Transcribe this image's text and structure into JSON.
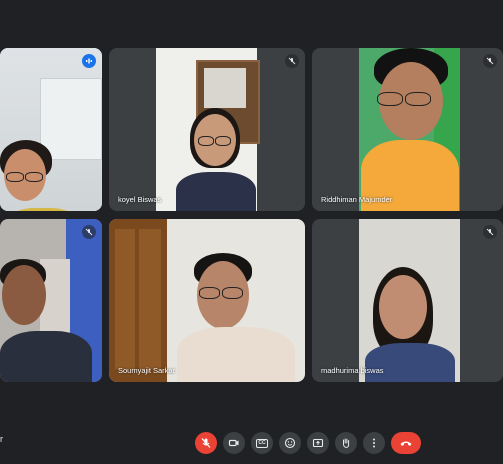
{
  "participants": [
    {
      "name": "",
      "muted": false,
      "speaking": true
    },
    {
      "name": "koyel Biswas",
      "muted": true
    },
    {
      "name": "Riddhiman Majumder",
      "muted": true
    },
    {
      "name": "",
      "muted": true
    },
    {
      "name": "Soumyajit Sarkar",
      "muted": true
    },
    {
      "name": "madhurima biswas",
      "muted": true
    }
  ],
  "bottom_left_text": "r",
  "controls": {
    "mic": "mic-off-icon",
    "camera": "camera-icon",
    "captions": "CC",
    "emoji": "emoji-icon",
    "present": "present-icon",
    "hand": "raise-hand-icon",
    "more": "more-options-icon",
    "end": "end-call-icon"
  },
  "colors": {
    "background": "#202124",
    "tile": "#3c4043",
    "active_border": "#8ab4f8",
    "end_call": "#ea4335",
    "speaking": "#1a73e8"
  }
}
